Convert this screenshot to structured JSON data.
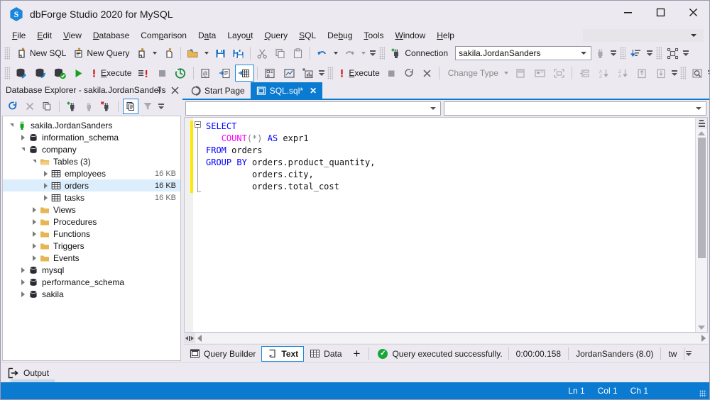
{
  "window": {
    "title": "dbForge Studio 2020 for MySQL",
    "logo_glyph": "S",
    "minimize": "–",
    "maximize": "□",
    "close": "✕"
  },
  "menu": {
    "items": [
      {
        "label": "File",
        "accel": "F"
      },
      {
        "label": "Edit",
        "accel": "E"
      },
      {
        "label": "View",
        "accel": "V"
      },
      {
        "label": "Database",
        "accel": "D"
      },
      {
        "label": "Comparison",
        "accel": "p"
      },
      {
        "label": "Data",
        "accel": "a"
      },
      {
        "label": "Layout",
        "accel": "u"
      },
      {
        "label": "Query",
        "accel": "Q"
      },
      {
        "label": "SQL",
        "accel": "S"
      },
      {
        "label": "Debug",
        "accel": "b"
      },
      {
        "label": "Tools",
        "accel": "T"
      },
      {
        "label": "Window",
        "accel": "W"
      },
      {
        "label": "Help",
        "accel": "H"
      }
    ],
    "search_placeholder": ""
  },
  "toolbar_main": {
    "new_sql": "New SQL",
    "new_query": "New Query",
    "connection_label": "Connection",
    "connection_value": "sakila.JordanSanders"
  },
  "toolbar_query": {
    "execute": "Execute",
    "execute2": "Execute",
    "change_type": "Change Type"
  },
  "db_explorer": {
    "title": "Database Explorer - sakila.JordanSanders",
    "pin": "⚲",
    "close": "✕",
    "tree": [
      {
        "label": "sakila.JordanSanders",
        "indent": 0,
        "icon": "connection-icon",
        "state": "expanded",
        "size": ""
      },
      {
        "label": "information_schema",
        "indent": 1,
        "icon": "database-icon",
        "state": "collapsed",
        "size": ""
      },
      {
        "label": "company",
        "indent": 1,
        "icon": "database-icon",
        "state": "expanded",
        "size": ""
      },
      {
        "label": "Tables (3)",
        "indent": 2,
        "icon": "folder-open-icon",
        "state": "expanded",
        "size": ""
      },
      {
        "label": "employees",
        "indent": 3,
        "icon": "table-icon",
        "state": "collapsed",
        "size": "16 KB"
      },
      {
        "label": "orders",
        "indent": 3,
        "icon": "table-icon",
        "state": "collapsed",
        "size": "16 KB",
        "selected": true
      },
      {
        "label": "tasks",
        "indent": 3,
        "icon": "table-icon",
        "state": "collapsed",
        "size": "16 KB"
      },
      {
        "label": "Views",
        "indent": 2,
        "icon": "folder-icon",
        "state": "collapsed",
        "size": ""
      },
      {
        "label": "Procedures",
        "indent": 2,
        "icon": "folder-icon",
        "state": "collapsed",
        "size": ""
      },
      {
        "label": "Functions",
        "indent": 2,
        "icon": "folder-icon",
        "state": "collapsed",
        "size": ""
      },
      {
        "label": "Triggers",
        "indent": 2,
        "icon": "folder-icon",
        "state": "collapsed",
        "size": ""
      },
      {
        "label": "Events",
        "indent": 2,
        "icon": "folder-icon",
        "state": "collapsed",
        "size": ""
      },
      {
        "label": "mysql",
        "indent": 1,
        "icon": "database-icon",
        "state": "collapsed",
        "size": ""
      },
      {
        "label": "performance_schema",
        "indent": 1,
        "icon": "database-icon",
        "state": "collapsed",
        "size": ""
      },
      {
        "label": "sakila",
        "indent": 1,
        "icon": "database-icon",
        "state": "collapsed",
        "size": ""
      }
    ]
  },
  "tabs": [
    {
      "label": "Start Page",
      "icon": "start-page-icon",
      "active": false,
      "closable": false
    },
    {
      "label": "SQL.sql*",
      "icon": "sql-document-icon",
      "active": true,
      "closable": true,
      "close": "✕"
    }
  ],
  "editor": {
    "combo_left_value": "",
    "combo_right_value": "",
    "code_lines": [
      [
        {
          "t": "SELECT",
          "c": "kw"
        }
      ],
      [
        {
          "t": "   ",
          "c": "p"
        },
        {
          "t": "COUNT",
          "c": "fn"
        },
        {
          "t": "(",
          "c": "punc"
        },
        {
          "t": "*",
          "c": "punc"
        },
        {
          "t": ")",
          "c": "punc"
        },
        {
          "t": " ",
          "c": "p"
        },
        {
          "t": "AS",
          "c": "kw"
        },
        {
          "t": " expr1",
          "c": "p"
        }
      ],
      [
        {
          "t": "FROM",
          "c": "kw"
        },
        {
          "t": " orders",
          "c": "p"
        }
      ],
      [
        {
          "t": "GROUP BY",
          "c": "kw"
        },
        {
          "t": " orders.product_quantity,",
          "c": "p"
        }
      ],
      [
        {
          "t": "         orders.city,",
          "c": "p"
        }
      ],
      [
        {
          "t": "         orders.total_cost",
          "c": "p"
        }
      ]
    ]
  },
  "result_bar": {
    "query_builder": "Query Builder",
    "text": "Text",
    "data": "Data",
    "add": "+",
    "status_text": "Query executed successfully.",
    "status_icon": "check-circle-icon",
    "elapsed": "0:00:00.158",
    "connection": "JordanSanders (8.0)",
    "extra": "tw"
  },
  "output": {
    "label": "Output",
    "icon": "output-icon"
  },
  "status_bar": {
    "line": "Ln 1",
    "col": "Col 1",
    "ch": "Ch 1"
  },
  "colors": {
    "accent": "#0b7ad1",
    "chrome": "#eceaf0",
    "keyword": "#0000ff",
    "function": "#ff00ff",
    "success": "#17a637",
    "change_marker": "#ffe800"
  }
}
